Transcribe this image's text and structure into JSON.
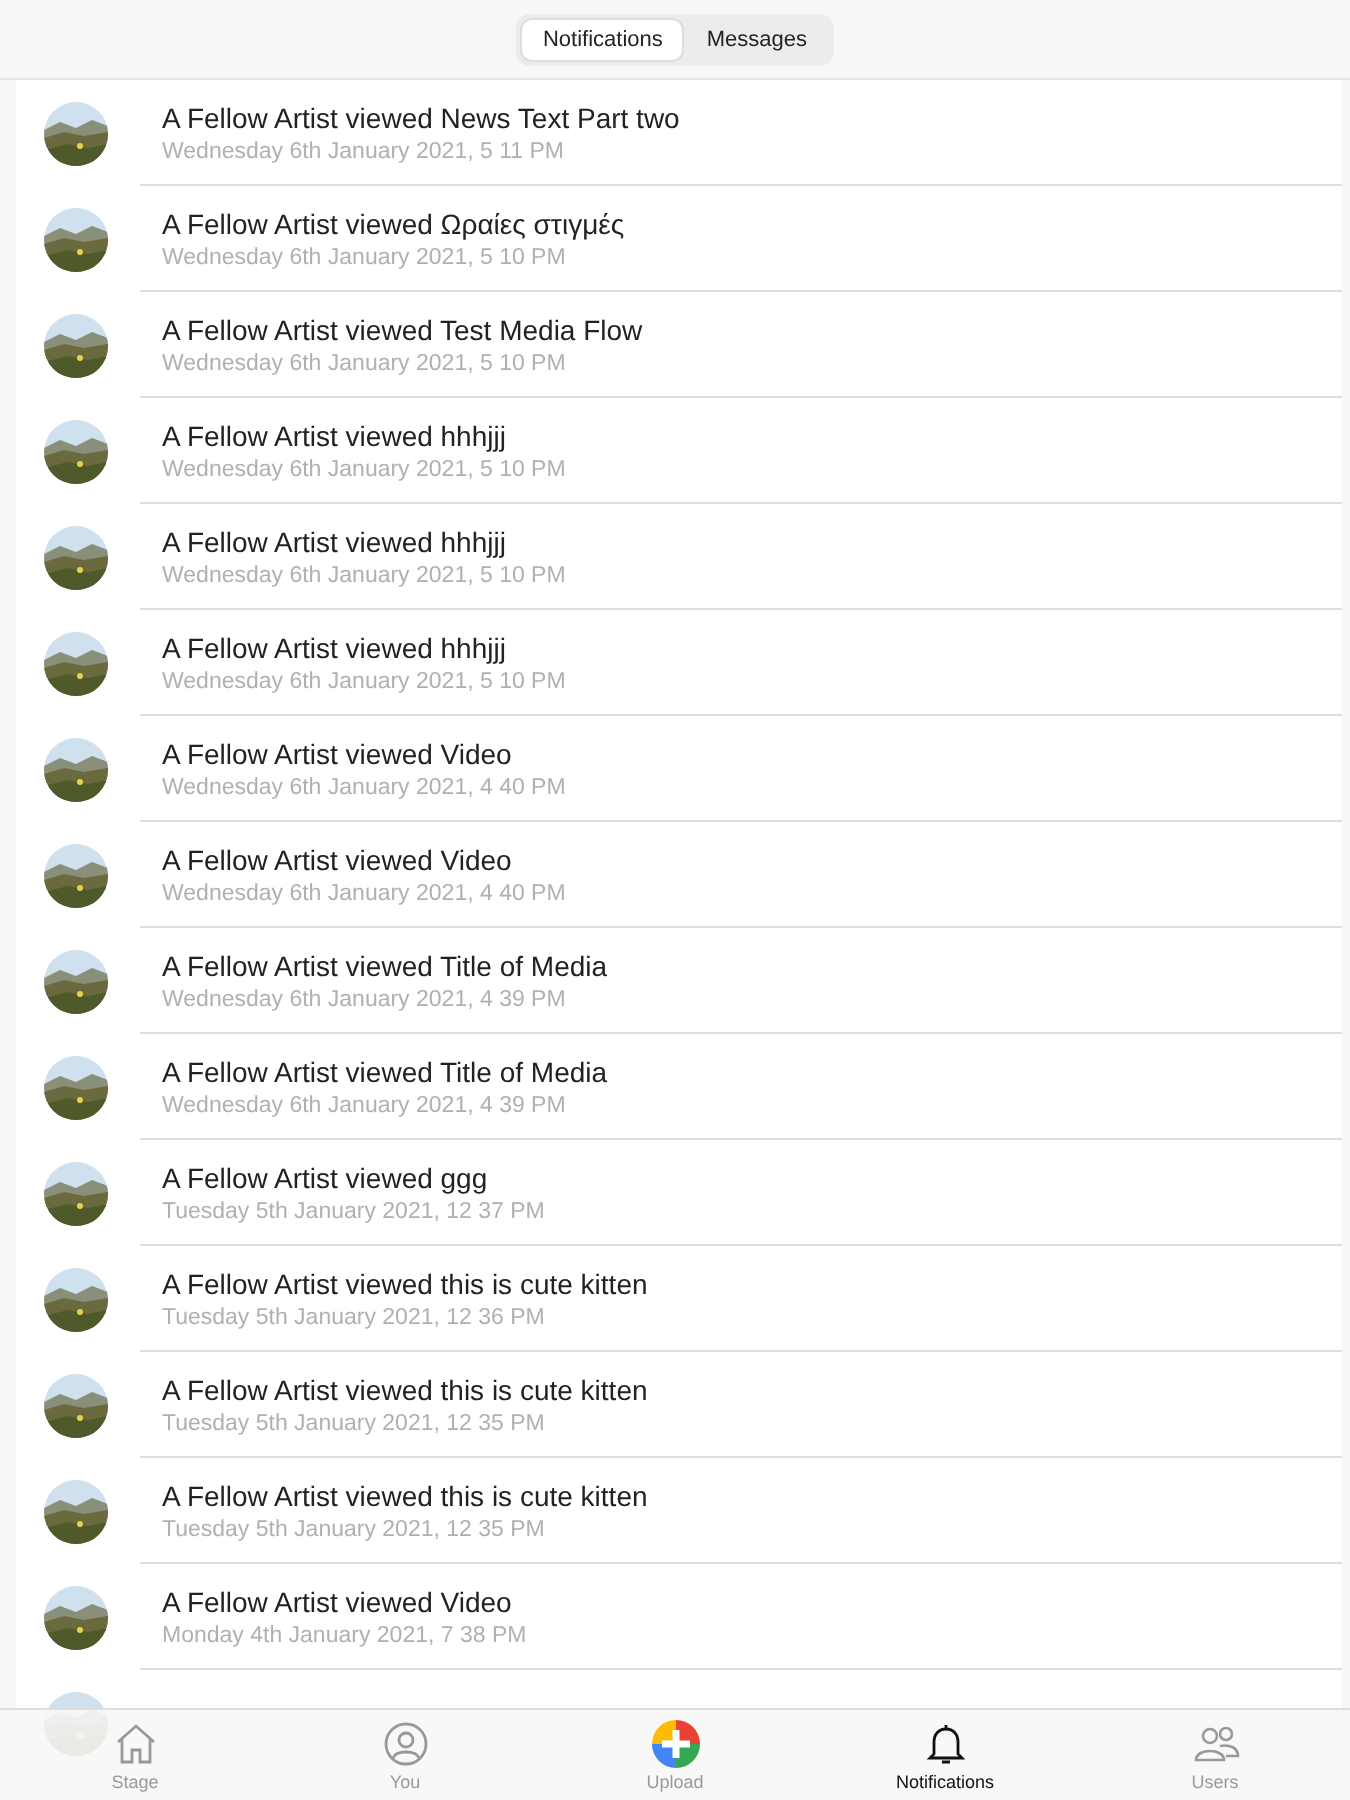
{
  "segments": [
    {
      "label": "Notifications",
      "selected": true
    },
    {
      "label": "Messages",
      "selected": false
    }
  ],
  "notifications": [
    {
      "title": "A Fellow Artist viewed News Text Part two",
      "time": "Wednesday 6th January 2021, 5 11 PM"
    },
    {
      "title": "A Fellow Artist viewed Ωραίες στιγμές",
      "time": "Wednesday 6th January 2021, 5 10 PM"
    },
    {
      "title": "A Fellow Artist viewed Test Media Flow",
      "time": "Wednesday 6th January 2021, 5 10 PM"
    },
    {
      "title": "A Fellow Artist viewed hhhjjj",
      "time": "Wednesday 6th January 2021, 5 10 PM"
    },
    {
      "title": "A Fellow Artist viewed hhhjjj",
      "time": "Wednesday 6th January 2021, 5 10 PM"
    },
    {
      "title": "A Fellow Artist viewed hhhjjj",
      "time": "Wednesday 6th January 2021, 5 10 PM"
    },
    {
      "title": "A Fellow Artist viewed Video",
      "time": "Wednesday 6th January 2021, 4 40 PM"
    },
    {
      "title": "A Fellow Artist viewed Video",
      "time": "Wednesday 6th January 2021, 4 40 PM"
    },
    {
      "title": "A Fellow Artist viewed Title of Media",
      "time": "Wednesday 6th January 2021, 4 39 PM"
    },
    {
      "title": "A Fellow Artist viewed Title of Media",
      "time": "Wednesday 6th January 2021, 4 39 PM"
    },
    {
      "title": "A Fellow Artist viewed ggg",
      "time": "Tuesday 5th January 2021, 12 37 PM"
    },
    {
      "title": "A Fellow Artist viewed this is cute kitten",
      "time": "Tuesday 5th January 2021, 12 36 PM"
    },
    {
      "title": "A Fellow Artist viewed this is cute kitten",
      "time": "Tuesday 5th January 2021, 12 35 PM"
    },
    {
      "title": "A Fellow Artist viewed this is cute kitten",
      "time": "Tuesday 5th January 2021, 12 35 PM"
    },
    {
      "title": "A Fellow Artist viewed Video",
      "time": "Monday 4th January 2021, 7 38 PM"
    },
    {
      "kind": "picture"
    }
  ],
  "tab_bar": [
    {
      "label": "Stage",
      "kind": "home",
      "selected": false
    },
    {
      "label": "You",
      "kind": "person",
      "selected": false
    },
    {
      "label": "Upload",
      "kind": "upload",
      "selected": false
    },
    {
      "label": "Notifications",
      "kind": "bell",
      "selected": true
    },
    {
      "label": "Users",
      "kind": "users",
      "selected": false
    }
  ]
}
